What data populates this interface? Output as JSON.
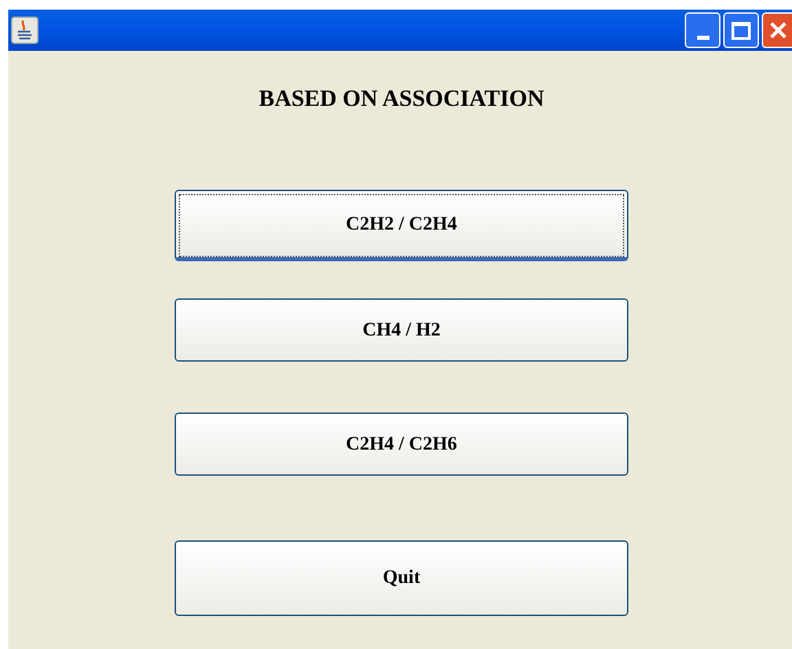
{
  "heading": "BASED ON ASSOCIATION",
  "buttons": [
    {
      "label": "C2H2 / C2H4",
      "focused": true
    },
    {
      "label": "CH4 / H2",
      "focused": false
    },
    {
      "label": "C2H4 / C2H6",
      "focused": false
    },
    {
      "label": "Quit",
      "focused": false
    }
  ]
}
